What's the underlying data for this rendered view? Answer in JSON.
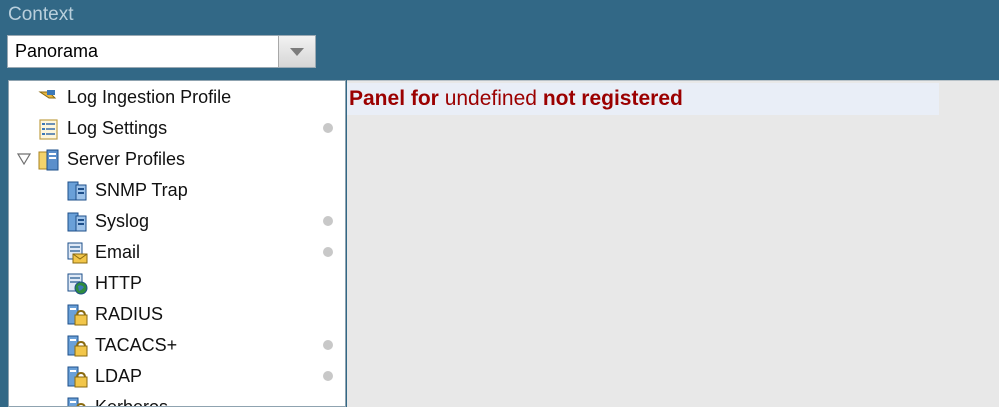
{
  "context": {
    "label": "Context",
    "selected": "Panorama"
  },
  "tree": {
    "items": [
      {
        "label": "Log Ingestion Profile",
        "icon": "log-ingestion-icon",
        "dot": false
      },
      {
        "label": "Log Settings",
        "icon": "log-settings-icon",
        "dot": true
      },
      {
        "label": "Server Profiles",
        "icon": "server-profiles-icon",
        "dot": false
      },
      {
        "label": "SNMP Trap",
        "icon": "snmp-trap-icon",
        "dot": false
      },
      {
        "label": "Syslog",
        "icon": "syslog-icon",
        "dot": true
      },
      {
        "label": "Email",
        "icon": "email-icon",
        "dot": true
      },
      {
        "label": "HTTP",
        "icon": "http-icon",
        "dot": false
      },
      {
        "label": "RADIUS",
        "icon": "radius-icon",
        "dot": false
      },
      {
        "label": "TACACS+",
        "icon": "tacacs-icon",
        "dot": true
      },
      {
        "label": "LDAP",
        "icon": "ldap-icon",
        "dot": true
      },
      {
        "label": "Kerberos",
        "icon": "kerberos-icon",
        "dot": false
      }
    ]
  },
  "content": {
    "part1": "Panel for",
    "part2": "undefined",
    "part3": "not registered"
  },
  "colors": {
    "header_bg": "#326886",
    "error_text": "#9b0000",
    "status_dot": "#c8c8c8"
  }
}
